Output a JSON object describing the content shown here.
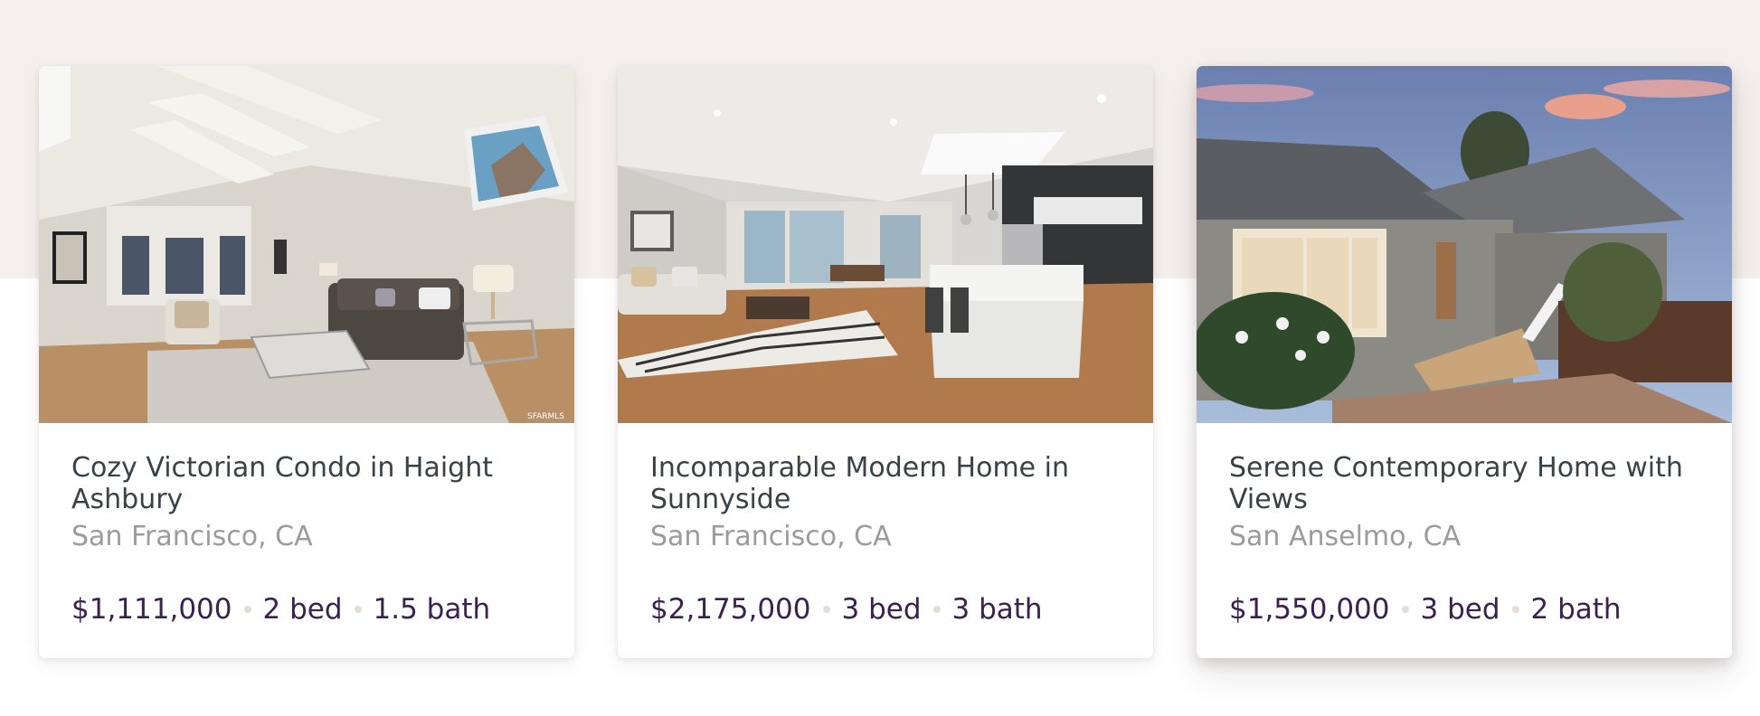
{
  "listings": [
    {
      "title": "Cozy Victorian Condo in Haight Ashbury",
      "location": "San Francisco, CA",
      "price": "$1,111,000",
      "beds": "2 bed",
      "baths": "1.5 bath",
      "photo_watermark": "SFARMLS"
    },
    {
      "title": "Incomparable Modern Home in Sunnyside",
      "location": "San Francisco, CA",
      "price": "$2,175,000",
      "beds": "3 bed",
      "baths": "3 bath"
    },
    {
      "title": "Serene Contemporary Home with Views",
      "location": "San Anselmo, CA",
      "price": "$1,550,000",
      "beds": "3 bed",
      "baths": "2 bath"
    }
  ],
  "colors": {
    "background_band": "#f4efec",
    "title": "#394149",
    "location": "#9b9b9b",
    "stats": "#3a2150",
    "separator_dot": "#e6dcd5"
  }
}
